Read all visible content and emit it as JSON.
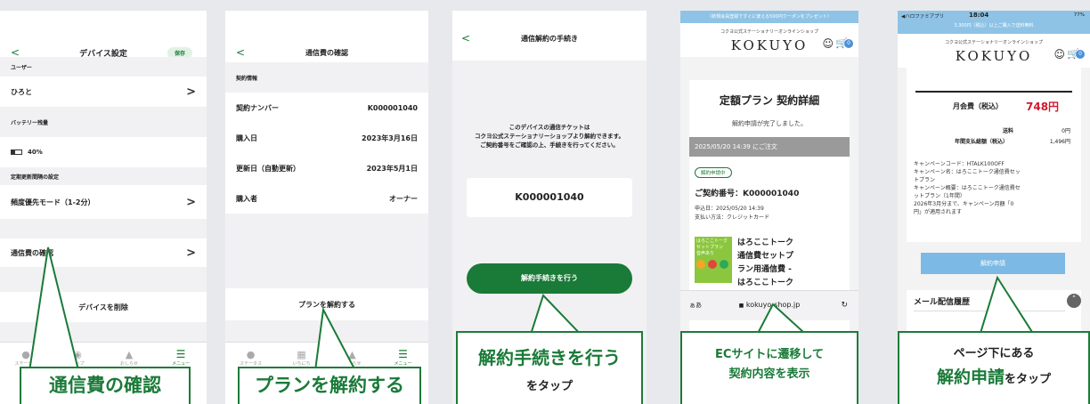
{
  "panel1": {
    "header": {
      "back": "<",
      "title": "デバイス設定",
      "save": "保存"
    },
    "sections": [
      {
        "label": "ユーザー",
        "value": "ひろと",
        "chevron": ">"
      },
      {
        "label": "バッテリー残量",
        "value": "40%"
      },
      {
        "label": "定期更新間隔の設定",
        "value": "頻度優先モード（1-2分）",
        "chevron": ">"
      }
    ],
    "billing_row": "通信費の確認",
    "delete_row": "デバイスを削除",
    "nav": [
      {
        "icon": "person-icon",
        "label": "ステータス"
      },
      {
        "icon": "pin-icon",
        "label": "マップ"
      },
      {
        "icon": "bell-icon",
        "label": "おしらせ"
      },
      {
        "icon": "menu-icon",
        "label": "メニュー"
      }
    ],
    "callout": "通信費の確認"
  },
  "panel2": {
    "header": {
      "back": "<",
      "title": "通信費の確認"
    },
    "section": "契約情報",
    "rows": [
      {
        "key": "契約ナンバー",
        "value": "K000001040"
      },
      {
        "key": "購入日",
        "value": "2023年3月16日"
      },
      {
        "key": "更新日（自動更新）",
        "value": "2023年5月1日"
      },
      {
        "key": "購入者",
        "value": "オーナー"
      }
    ],
    "cancel_row": "プランを解約する",
    "nav": [
      {
        "icon": "person-icon",
        "label": "ステータス"
      },
      {
        "icon": "calendar-icon",
        "label": "いちにち"
      },
      {
        "icon": "bell-icon",
        "label": "おしらせ"
      },
      {
        "icon": "menu-icon",
        "label": "メニュー"
      }
    ],
    "callout": "プランを解約する"
  },
  "panel3": {
    "header": {
      "back": "<",
      "title": "通信解約の手続き"
    },
    "desc": [
      "このデバイスの通信チケットは",
      "コクヨ公式ステーショナリーショップより解約できます。",
      "ご契約番号をご確認の上、手続きを行ってください。"
    ],
    "contract_number": "K000001040",
    "button": "解約手続きを行う",
    "callout_big": "解約手続きを行う",
    "callout_small": "をタップ"
  },
  "panel4": {
    "banner": "〈新規会員登録ですぐに使える500円クーポンをプレゼント〉",
    "shop_sub": "コクヨ公式ステーショナリーオンラインショップ",
    "logo": "KOKUYO",
    "cart_count": "0",
    "title": "定額プラン 契約詳細",
    "done": "解約申請が完了しました。",
    "order_bar": "2025/05/20 14:39 にご注文",
    "badge": "解約申請中",
    "contract": "ご契約番号：K000001040",
    "applied": "申込日：2025/05/20 14:39",
    "payment": "支払い方法：クレジットカード",
    "product_lines": [
      "はろここトーク",
      "通信費セットプ",
      "ラン用通信費 -",
      "はろここトーク"
    ],
    "thumb": [
      "はろここトーク",
      "セットプラン",
      "音声あり"
    ],
    "addr_aa": "ぁあ",
    "addr_url": "kokuyo-shop.jp",
    "callout": [
      "ECサイトに遷移して",
      "契約内容を表示"
    ]
  },
  "panel5": {
    "status": {
      "carrier": "◀ハロファミアプリ",
      "time": "18:04",
      "battery": "77%"
    },
    "banner": "3,300円（税込）以上ご購入で送料無料",
    "shop_sub": "コクヨ公式ステーショナリーオンラインショップ",
    "logo": "KOKUYO",
    "cart_count": "0",
    "monthly_label": "月会費（税込）",
    "monthly_value": "748円",
    "shipping_label": "送料",
    "shipping_value": "0円",
    "annual_label": "年間支払総額（税込）",
    "annual_value": "1,496円",
    "campaign": [
      "キャンペーンコード：HTALK100OFF",
      "キャンペーン名：はろここトーク通信費セッ",
      "トプラン",
      "キャンペーン概要：はろここトーク通信費セ",
      "ットプラン（1年間）",
      "2026年3月分まで、キャンペーン月額「0",
      "円」が適用されます"
    ],
    "button": "解約申請",
    "mail_history": "メール配信履歴",
    "callout_line1": "ページ下にある",
    "callout_big": "解約申請",
    "callout_suffix": "をタップ"
  },
  "colors": {
    "green": "#1a7a38",
    "red": "#d4182f",
    "banner_blue": "#8ec3e6",
    "apply_blue": "#7cb9e4"
  }
}
